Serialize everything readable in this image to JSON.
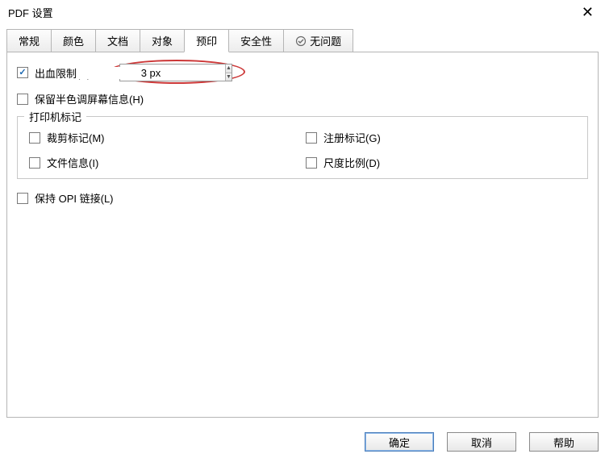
{
  "title": "PDF 设置",
  "tabs": {
    "general": "常规",
    "color": "颜色",
    "document": "文档",
    "objects": "对象",
    "prepress": "预印",
    "security": "安全性",
    "no_issues": "无问题"
  },
  "prepress": {
    "bleed_label": "出血限制(B):",
    "bleed_value": "3 px",
    "preserve_halftone": "保留半色调屏幕信息(H)",
    "printer_marks_legend": "打印机标记",
    "crop_marks": "裁剪标记(M)",
    "registration_marks": "注册标记(G)",
    "file_info": "文件信息(I)",
    "scale_ratio": "尺度比例(D)",
    "maintain_opi": "保持 OPI 链接(L)"
  },
  "buttons": {
    "ok": "确定",
    "cancel": "取消",
    "help": "帮助"
  }
}
